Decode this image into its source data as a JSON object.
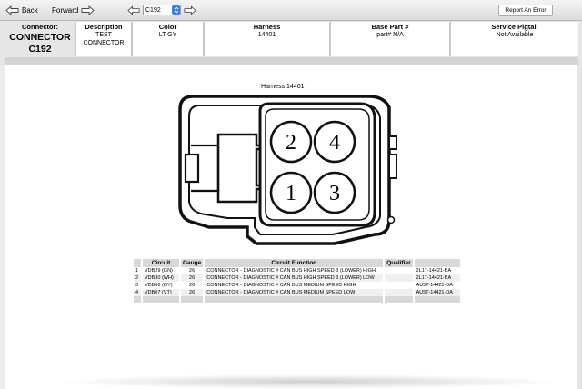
{
  "toolbar": {
    "back_label": "Back",
    "forward_label": "Forward",
    "connector_select_value": "C192",
    "report_error_label": "Report An Error"
  },
  "header": {
    "connector_heading": "Connector:",
    "connector_name_line1": "CONNECTOR",
    "connector_name_line2": "C192",
    "columns": [
      {
        "heading": "Description",
        "value_line1": "TEST",
        "value_line2": "CONNECTOR"
      },
      {
        "heading": "Color",
        "value_line1": "LT GY",
        "value_line2": ""
      },
      {
        "heading": "Harness",
        "value_line1": "14401",
        "value_line2": ""
      },
      {
        "heading": "Base Part #",
        "value_line1": "part# N/A",
        "value_line2": ""
      },
      {
        "heading": "Service Pigtail",
        "value_line1": "Not Available",
        "value_line2": ""
      }
    ]
  },
  "diagram": {
    "title": "Harness  14401",
    "pins": [
      "2",
      "4",
      "1",
      "3"
    ]
  },
  "circuit_table": {
    "headers": [
      "",
      "Circuit",
      "Gauge",
      "Circuit Function",
      "Qualifier",
      ""
    ],
    "rows": [
      {
        "pin": "1",
        "circuit": "VDB29 (GN)",
        "gauge": "26",
        "function": "CONNECTOR - DIAGNOSTIC # CAN BUS HIGH SPEED 3 (LOWER) HIGH",
        "qualifier": "",
        "part": "2L1T-14421-BA"
      },
      {
        "pin": "2",
        "circuit": "VDB30 (WH)",
        "gauge": "26",
        "function": "CONNECTOR - DIAGNOSTIC # CAN BUS HIGH SPEED 3 (LOWER) LOW",
        "qualifier": "",
        "part": "2L1T-14421-BA"
      },
      {
        "pin": "3",
        "circuit": "VDB06 (GY)",
        "gauge": "26",
        "function": "CONNECTOR - DIAGNOSTIC # CAN BUS MEDIUM SPEED HIGH",
        "qualifier": "",
        "part": "AU5T-14421-DA"
      },
      {
        "pin": "4",
        "circuit": "VDB07 (VT)",
        "gauge": "26",
        "function": "CONNECTOR - DIAGNOSTIC # CAN BUS MEDIUM SPEED LOW",
        "qualifier": "",
        "part": "AU5T-14421-DA"
      }
    ]
  },
  "colors": {
    "select_accent": "#3a7fe0",
    "header_divider": "#c9c9c9"
  }
}
